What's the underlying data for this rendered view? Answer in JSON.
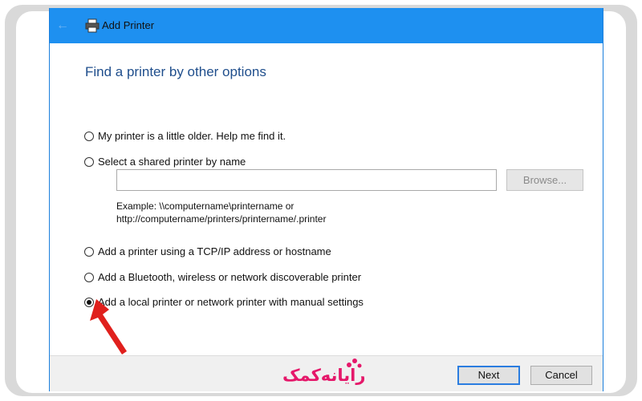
{
  "window": {
    "title": "Add Printer",
    "heading": "Find a printer by other options"
  },
  "options": [
    {
      "label": "My printer is a little older. Help me find it.",
      "checked": false
    },
    {
      "label": "Select a shared printer by name",
      "checked": false
    },
    {
      "label": "Add a printer using a TCP/IP address or hostname",
      "checked": false
    },
    {
      "label": "Add a Bluetooth, wireless or network discoverable printer",
      "checked": false
    },
    {
      "label": "Add a local printer or network printer with manual settings",
      "checked": true
    }
  ],
  "shared_printer": {
    "input_value": "",
    "browse_label": "Browse...",
    "example_line1": "Example: \\\\computername\\printername or",
    "example_line2": "http://computername/printers/printername/.printer"
  },
  "footer": {
    "next_label": "Next",
    "cancel_label": "Cancel"
  },
  "watermark": {
    "text": "رایانه‌کمک",
    "color": "#e5186a"
  },
  "colors": {
    "titlebar": "#1e90f0",
    "heading": "#1f4e8c",
    "next_border": "#2b7de0",
    "annotation_arrow": "#e0201d"
  },
  "icons": [
    "back-arrow-icon",
    "printer-icon",
    "red-arrow-icon"
  ]
}
